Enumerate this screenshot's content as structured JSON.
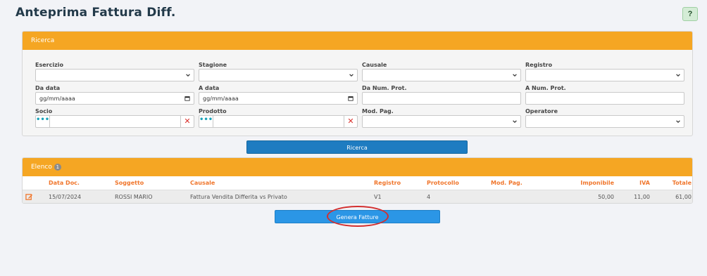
{
  "page": {
    "title": "Anteprima Fattura Diff.",
    "help_label": "?"
  },
  "search": {
    "header": "Ricerca",
    "fields": {
      "esercizio": {
        "label": "Esercizio",
        "value": ""
      },
      "stagione": {
        "label": "Stagione",
        "value": ""
      },
      "causale": {
        "label": "Causale",
        "value": ""
      },
      "registro": {
        "label": "Registro",
        "value": ""
      },
      "da_data": {
        "label": "Da data",
        "value": "gg/mm/aaaa"
      },
      "a_data": {
        "label": "A data",
        "value": "gg/mm/aaaa"
      },
      "da_num_prot": {
        "label": "Da Num. Prot.",
        "value": ""
      },
      "a_num_prot": {
        "label": "A Num. Prot.",
        "value": ""
      },
      "socio": {
        "label": "Socio",
        "value": ""
      },
      "prodotto": {
        "label": "Prodotto",
        "value": ""
      },
      "mod_pag": {
        "label": "Mod. Pag.",
        "value": ""
      },
      "operatore": {
        "label": "Operatore",
        "value": ""
      }
    },
    "lookup_dots": "•••",
    "clear_symbol": "✕",
    "button_label": "Ricerca"
  },
  "list": {
    "header": "Elenco",
    "count": "1",
    "columns": [
      "Data Doc.",
      "Soggetto",
      "Causale",
      "Registro",
      "Protocollo",
      "Mod. Pag.",
      "Imponibile",
      "IVA",
      "Totale"
    ],
    "rows": [
      {
        "data_doc": "15/07/2024",
        "soggetto": "ROSSI MARIO",
        "causale": "Fattura Vendita Differita vs Privato",
        "registro": "V1",
        "protocollo": "4",
        "mod_pag": "",
        "imponibile": "50,00",
        "iva": "11,00",
        "totale": "61,00"
      }
    ]
  },
  "actions": {
    "genera_label": "Genera Fatture"
  },
  "icons": {
    "edit": "edit-icon",
    "calendar": "calendar-icon",
    "chevron": "chevron-down-icon"
  },
  "colors": {
    "accent": "#f5a623",
    "primary": "#1e7cc1",
    "header_text": "#f0762c",
    "highlight": "#d32f2f"
  }
}
